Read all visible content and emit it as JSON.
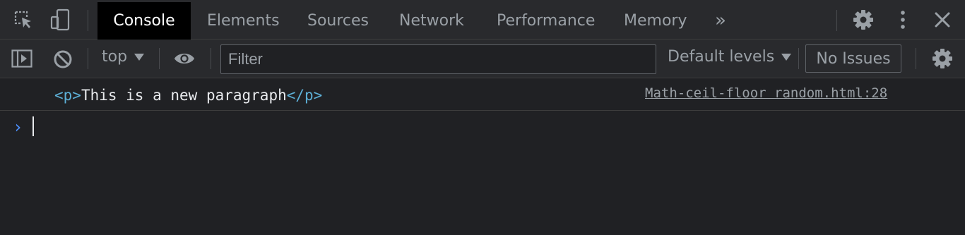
{
  "tabs": [
    {
      "label": "Console",
      "active": true
    },
    {
      "label": "Elements",
      "active": false
    },
    {
      "label": "Sources",
      "active": false
    },
    {
      "label": "Network",
      "active": false
    },
    {
      "label": "Performance",
      "active": false
    },
    {
      "label": "Memory",
      "active": false
    }
  ],
  "tabbar": {
    "more_tabs_glyph": "»",
    "icons": [
      "inspect-element-icon",
      "device-toolbar-icon",
      "settings-icon",
      "more-options-icon",
      "close-icon"
    ]
  },
  "toolbar": {
    "context": "top",
    "filter_placeholder": "Filter",
    "filter_value": "",
    "levels": "Default levels",
    "issues": "No Issues",
    "icons": [
      "sidebar-toggle-icon",
      "clear-console-icon",
      "eye-icon",
      "console-settings-icon"
    ]
  },
  "console": {
    "messages": [
      {
        "open_tag": "<p>",
        "text": "This is a new paragraph",
        "close_tag": "</p>",
        "source": "Math-ceil-floor random.html:28"
      }
    ],
    "prompt_glyph": "›"
  },
  "colors": {
    "background": "#202124",
    "toolbar": "#292a2d",
    "active_tab": "#000000",
    "tag": "#5db0d7",
    "prompt": "#4d90fe"
  }
}
